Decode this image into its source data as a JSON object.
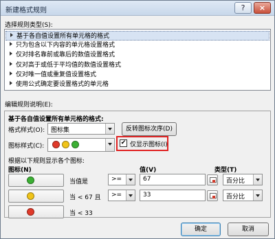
{
  "window": {
    "title": "新建格式规则"
  },
  "rule_type": {
    "label": "选择规则类型(S):",
    "items": [
      "基于各自值设置所有单元格的格式",
      "只为包含以下内容的单元格设置格式",
      "仅对排名靠前或靠后的数值设置格式",
      "仅对高于或低于平均值的数值设置格式",
      "仅对唯一值或重复值设置格式",
      "使用公式确定要设置格式的单元格"
    ],
    "selected_index": 0
  },
  "edit": {
    "label": "编辑规则说明(E):",
    "heading": "基于各自值设置所有单元格的格式:",
    "format_style_label": "格式样式(O):",
    "format_style_value": "图标集",
    "reverse_button": "反转图标次序(D)",
    "icon_style_label": "图标样式(C):",
    "show_icon_only_label": "仅显示图标(I)",
    "show_icon_only_checked": true,
    "rules_caption": "根据以下规则显示各个图标:",
    "col_icon": "图标(N)",
    "col_value": "值(V)",
    "col_type": "类型(T)",
    "rows": [
      {
        "dot": "#3cb034",
        "cond": "当值是",
        "op": ">=",
        "value": "67",
        "type": "百分比"
      },
      {
        "dot": "#f0c419",
        "cond": "当 < 67 且",
        "op": ">=",
        "value": "33",
        "type": "百分比"
      },
      {
        "dot": "#e03a2a",
        "cond": "当 < 33",
        "op": "",
        "value": "",
        "type": ""
      }
    ],
    "style_dots": [
      "#e03a2a",
      "#f0c419",
      "#3cb034"
    ]
  },
  "buttons": {
    "ok": "确定",
    "cancel": "取消"
  },
  "icons": {
    "help": "?",
    "close": "×"
  }
}
